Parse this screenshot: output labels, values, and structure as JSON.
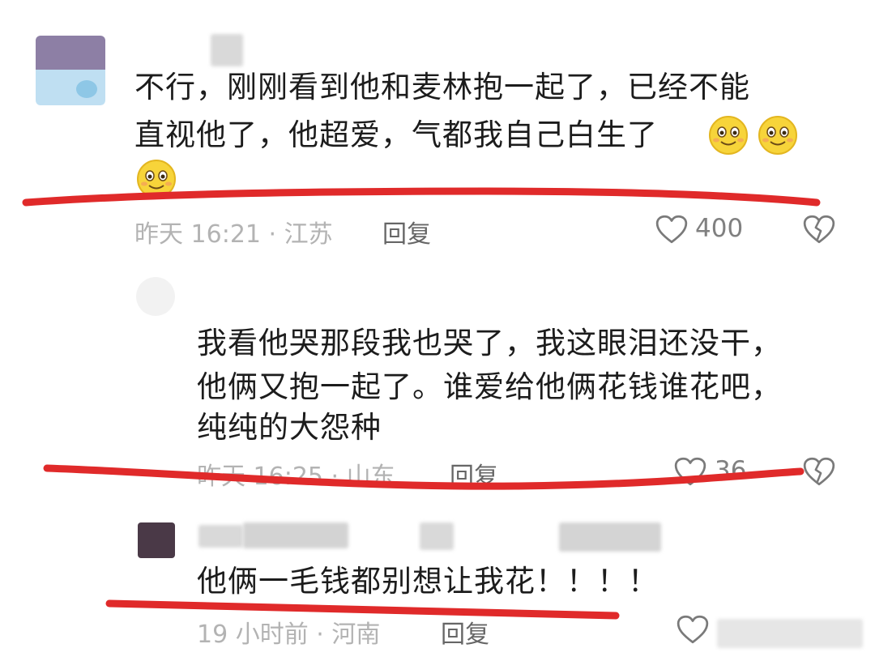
{
  "comments": [
    {
      "text_line1": "不行，刚刚看到他和麦林抱一起了，已经不能",
      "text_line2": "直视他了，他超爱，气都我自己白生了",
      "time_location": "昨天 16:21 · 江苏",
      "reply_label": "回复",
      "like_count": "400",
      "emoji": "smiley-emoji"
    },
    {
      "text_line1": "我看他哭那段我也哭了，我这眼泪还没干，",
      "text_line2": "他俩又抱一起了。谁爱给他俩花钱谁花吧，",
      "text_line3": "纯纯的大怨种",
      "time_location": "昨天 16:25 · 山东",
      "reply_label": "回复",
      "like_count": "36"
    },
    {
      "text_line1": "他俩一毛钱都别想让我花！！！！",
      "time_location": "19 小时前 · 河南",
      "reply_label": "回复"
    }
  ],
  "colors": {
    "underline": "#e02a2a",
    "emoji_face": "#f7d43a",
    "meta_text": "#b3b3b3"
  }
}
